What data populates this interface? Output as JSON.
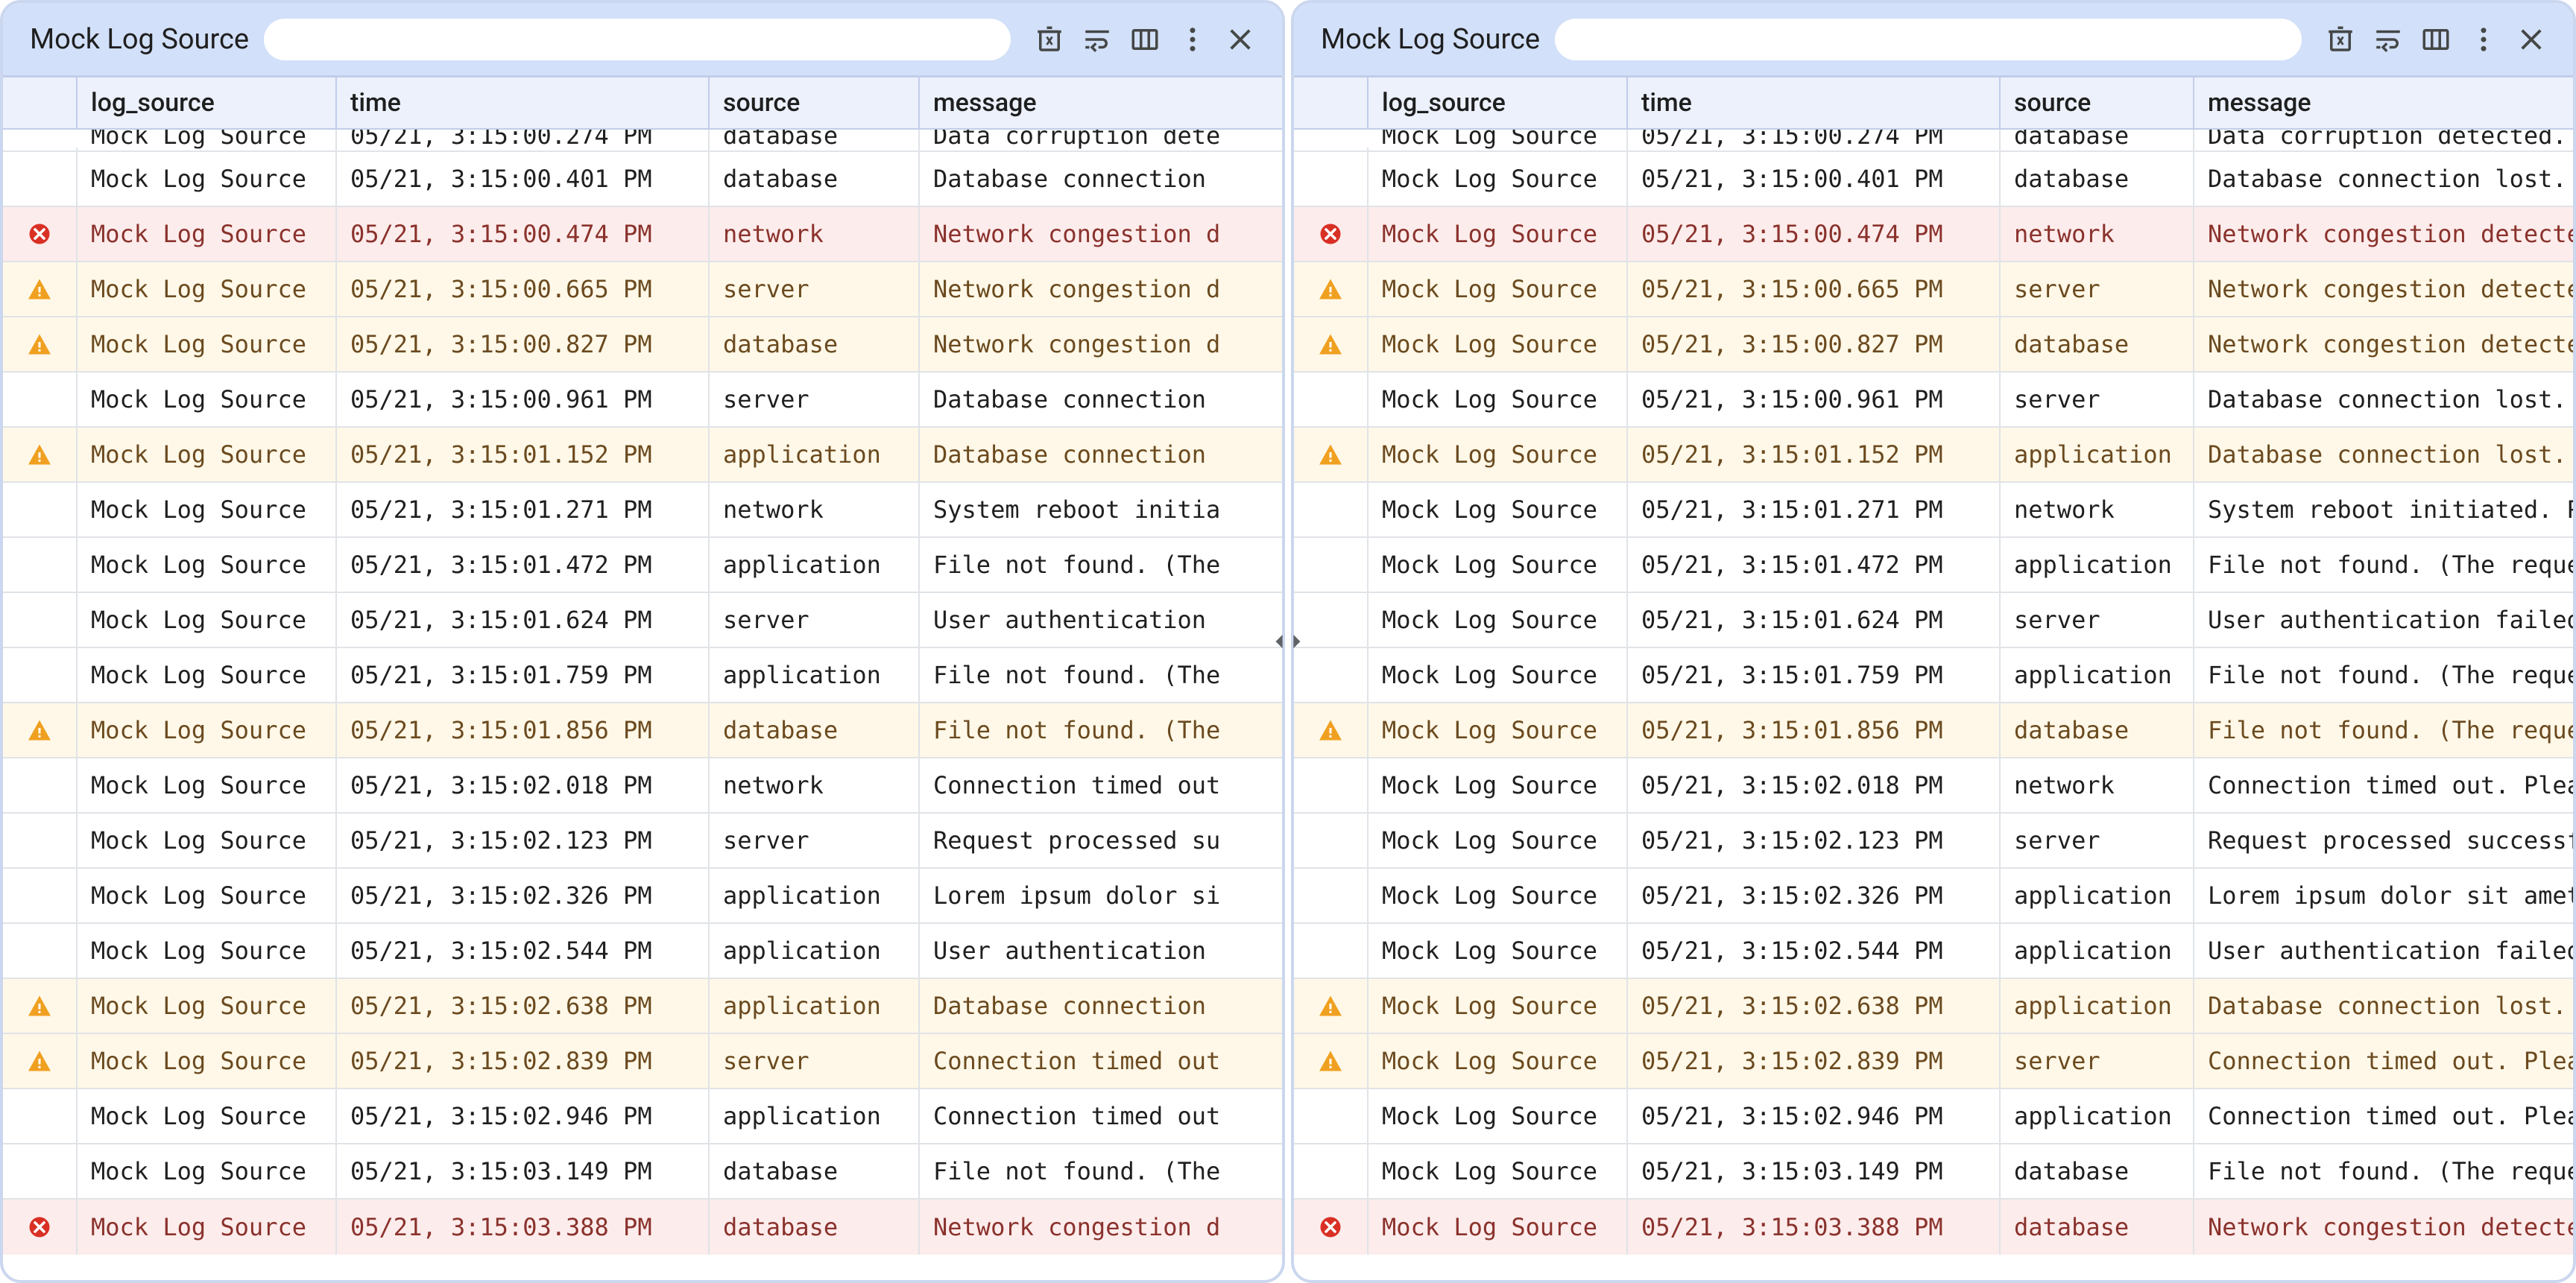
{
  "panel": {
    "title": "Mock Log Source",
    "search_placeholder": ""
  },
  "columns": {
    "log_source": "log_source",
    "time": "time",
    "source": "source",
    "message": "message"
  },
  "messages": {
    "short": {
      "data_corruption": "Data corruption dete",
      "db_conn_lost": "Database connection",
      "net_congestion": "Network congestion d",
      "sys_reboot": "System reboot initia",
      "file_not_found": "File not found. (The",
      "user_auth": "User authentication",
      "conn_timeout": "Connection timed out",
      "req_processed": "Request processed su",
      "lorem": "Lorem ipsum dolor si"
    },
    "long": {
      "data_corruption": "Data corruption detected. In",
      "db_conn_lost": "Database connection lost. Att",
      "net_congestion": "Network congestion detected.",
      "sys_reboot": "System reboot initiated. Plea",
      "file_not_found": "File not found. (The requeste",
      "user_auth": "User authentication failed. I",
      "conn_timeout": "Connection timed out. Please",
      "req_processed": "Request processed successfull",
      "lorem": "Lorem ipsum dolor sit amet, c"
    }
  },
  "rows": [
    {
      "level": "info",
      "log_source": "Mock Log Source",
      "time": "05/21, 3:15:00.274 PM",
      "source": "database",
      "msg_key": "data_corruption"
    },
    {
      "level": "info",
      "log_source": "Mock Log Source",
      "time": "05/21, 3:15:00.401 PM",
      "source": "database",
      "msg_key": "db_conn_lost"
    },
    {
      "level": "error",
      "log_source": "Mock Log Source",
      "time": "05/21, 3:15:00.474 PM",
      "source": "network",
      "msg_key": "net_congestion"
    },
    {
      "level": "warn",
      "log_source": "Mock Log Source",
      "time": "05/21, 3:15:00.665 PM",
      "source": "server",
      "msg_key": "net_congestion"
    },
    {
      "level": "warn",
      "log_source": "Mock Log Source",
      "time": "05/21, 3:15:00.827 PM",
      "source": "database",
      "msg_key": "net_congestion"
    },
    {
      "level": "info",
      "log_source": "Mock Log Source",
      "time": "05/21, 3:15:00.961 PM",
      "source": "server",
      "msg_key": "db_conn_lost"
    },
    {
      "level": "warn",
      "log_source": "Mock Log Source",
      "time": "05/21, 3:15:01.152 PM",
      "source": "application",
      "msg_key": "db_conn_lost"
    },
    {
      "level": "info",
      "log_source": "Mock Log Source",
      "time": "05/21, 3:15:01.271 PM",
      "source": "network",
      "msg_key": "sys_reboot"
    },
    {
      "level": "info",
      "log_source": "Mock Log Source",
      "time": "05/21, 3:15:01.472 PM",
      "source": "application",
      "msg_key": "file_not_found"
    },
    {
      "level": "info",
      "log_source": "Mock Log Source",
      "time": "05/21, 3:15:01.624 PM",
      "source": "server",
      "msg_key": "user_auth"
    },
    {
      "level": "info",
      "log_source": "Mock Log Source",
      "time": "05/21, 3:15:01.759 PM",
      "source": "application",
      "msg_key": "file_not_found"
    },
    {
      "level": "warn",
      "log_source": "Mock Log Source",
      "time": "05/21, 3:15:01.856 PM",
      "source": "database",
      "msg_key": "file_not_found"
    },
    {
      "level": "info",
      "log_source": "Mock Log Source",
      "time": "05/21, 3:15:02.018 PM",
      "source": "network",
      "msg_key": "conn_timeout"
    },
    {
      "level": "info",
      "log_source": "Mock Log Source",
      "time": "05/21, 3:15:02.123 PM",
      "source": "server",
      "msg_key": "req_processed"
    },
    {
      "level": "info",
      "log_source": "Mock Log Source",
      "time": "05/21, 3:15:02.326 PM",
      "source": "application",
      "msg_key": "lorem"
    },
    {
      "level": "info",
      "log_source": "Mock Log Source",
      "time": "05/21, 3:15:02.544 PM",
      "source": "application",
      "msg_key": "user_auth"
    },
    {
      "level": "warn",
      "log_source": "Mock Log Source",
      "time": "05/21, 3:15:02.638 PM",
      "source": "application",
      "msg_key": "db_conn_lost"
    },
    {
      "level": "warn",
      "log_source": "Mock Log Source",
      "time": "05/21, 3:15:02.839 PM",
      "source": "server",
      "msg_key": "conn_timeout"
    },
    {
      "level": "info",
      "log_source": "Mock Log Source",
      "time": "05/21, 3:15:02.946 PM",
      "source": "application",
      "msg_key": "conn_timeout"
    },
    {
      "level": "info",
      "log_source": "Mock Log Source",
      "time": "05/21, 3:15:03.149 PM",
      "source": "database",
      "msg_key": "file_not_found"
    },
    {
      "level": "error",
      "log_source": "Mock Log Source",
      "time": "05/21, 3:15:03.388 PM",
      "source": "database",
      "msg_key": "net_congestion"
    }
  ]
}
